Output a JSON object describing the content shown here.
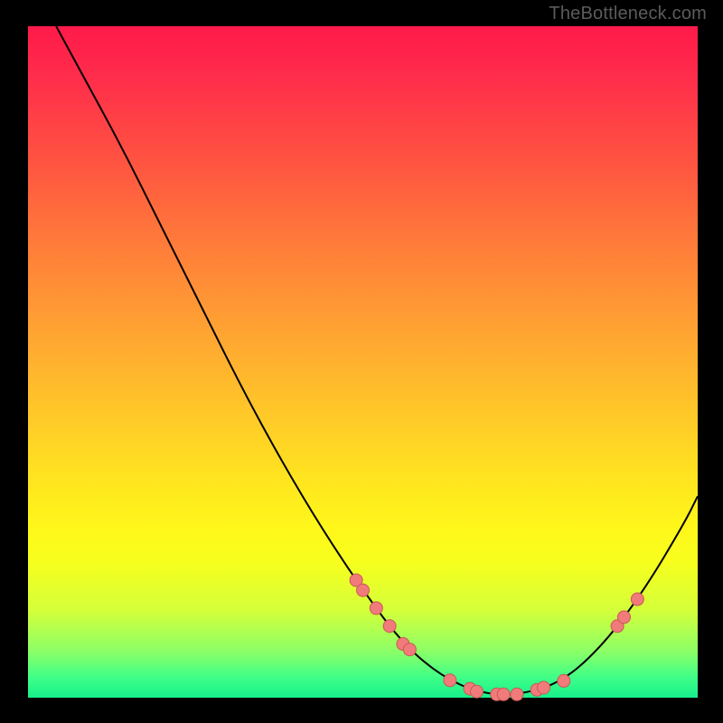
{
  "watermark": "TheBottleneck.com",
  "chart_data": {
    "type": "line",
    "title": "",
    "xlabel": "",
    "ylabel": "",
    "xlim": [
      0,
      100
    ],
    "ylim": [
      0,
      100
    ],
    "curve": [
      {
        "x": 4.2,
        "y": 100
      },
      {
        "x": 8,
        "y": 93
      },
      {
        "x": 14,
        "y": 82
      },
      {
        "x": 20,
        "y": 70
      },
      {
        "x": 26,
        "y": 58
      },
      {
        "x": 32,
        "y": 46
      },
      {
        "x": 38,
        "y": 35
      },
      {
        "x": 44,
        "y": 25
      },
      {
        "x": 50,
        "y": 16
      },
      {
        "x": 56,
        "y": 8
      },
      {
        "x": 62,
        "y": 3
      },
      {
        "x": 68,
        "y": 0.5
      },
      {
        "x": 74,
        "y": 0.5
      },
      {
        "x": 80,
        "y": 2.5
      },
      {
        "x": 86,
        "y": 8
      },
      {
        "x": 92,
        "y": 16
      },
      {
        "x": 98,
        "y": 26
      },
      {
        "x": 100,
        "y": 30
      }
    ],
    "markers_on_curve_x": [
      49,
      50,
      52,
      54,
      56,
      57,
      63,
      66,
      67,
      70,
      71,
      73,
      76,
      77,
      80,
      88,
      89,
      91
    ],
    "marker_color": "#f17b7b",
    "marker_stroke": "#c95856",
    "curve_color": "#000000"
  }
}
